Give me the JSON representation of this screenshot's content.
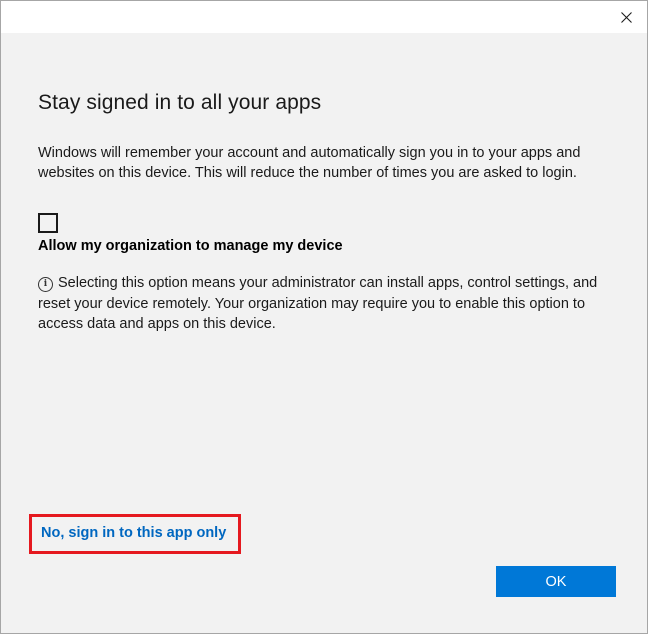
{
  "dialog": {
    "heading": "Stay signed in to all your apps",
    "description": "Windows will remember your account and automatically sign you in to your apps and websites on this device. This will reduce the number of times you are asked to login.",
    "checkbox": {
      "checked": false,
      "label": "Allow my organization to manage my device"
    },
    "info_icon": "info-circle-icon",
    "info_text": "Selecting this option means your administrator can install apps, control settings, and reset your device remotely. Your organization may require you to enable this option to access data and apps on this device.",
    "link_text": "No, sign in to this app only",
    "ok_label": "OK"
  },
  "titlebar": {
    "close_icon": "close-icon"
  },
  "colors": {
    "accent": "#0078d7",
    "link": "#0067c0",
    "highlight": "#e5191f",
    "background": "#f2f2f2"
  }
}
